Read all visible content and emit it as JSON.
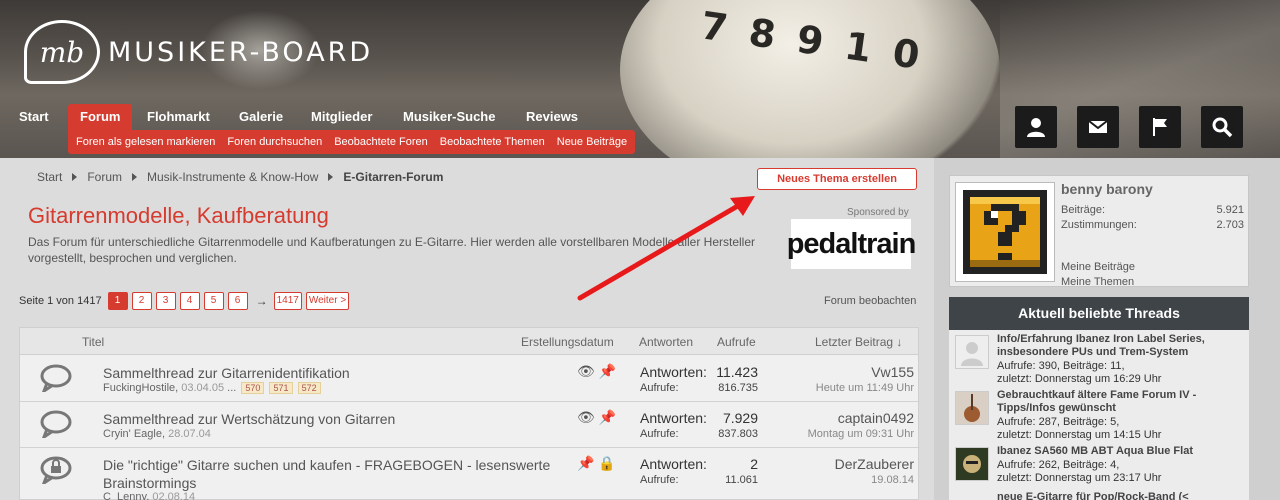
{
  "brand": {
    "name": "MUSIKER-BOARD",
    "accent": "#d63b2f"
  },
  "nav": {
    "items": [
      "Start",
      "Forum",
      "Flohmarkt",
      "Galerie",
      "Mitglieder",
      "Musiker-Suche",
      "Reviews"
    ],
    "active": "Forum",
    "subnav": [
      "Foren als gelesen markieren",
      "Foren durchsuchen",
      "Beobachtete Foren",
      "Beobachtete Themen",
      "Neue Beiträge"
    ],
    "icon_buttons": [
      "user-icon",
      "mail-icon",
      "flag-icon",
      "search-icon"
    ]
  },
  "breadcrumb": [
    "Start",
    "Forum",
    "Musik-Instrumente & Know-How",
    "E-Gitarren-Forum"
  ],
  "new_thread_label": "Neues Thema erstellen",
  "page": {
    "title": "Gitarrenmodelle, Kaufberatung",
    "description": "Das Forum für unterschiedliche Gitarrenmodelle und Kaufberatungen zu E-Gitarre. Hier werden alle vorstellbaren Modelle aller Hersteller vorgestellt, besprochen und verglichen."
  },
  "sponsor": {
    "label": "Sponsored by",
    "name": "pedaltrain"
  },
  "pagination": {
    "label": "Seite 1 von 1417",
    "pages": [
      "1",
      "2",
      "3",
      "4",
      "5",
      "6"
    ],
    "current": "1",
    "arrow": "→",
    "last": "1417",
    "next": "Weiter >"
  },
  "watch_forum": "Forum beobachten",
  "table": {
    "columns": {
      "title": "Titel",
      "created": "Erstellungsdatum",
      "answers": "Antworten",
      "views": "Aufrufe",
      "last": "Letzter Beitrag ↓"
    },
    "rows": [
      {
        "title": "Sammelthread zur Gitarrenidentifikation",
        "author": "FuckingHostile",
        "date": "03.04.05",
        "ellipsis": "...",
        "mini_pages": [
          "570",
          "571",
          "572"
        ],
        "answers_label": "Antworten:",
        "answers": "11.423",
        "views_label": "Aufrufe:",
        "views": "816.735",
        "last_user": "Vw155",
        "last_date": "Heute um 11:49 Uhr"
      },
      {
        "title": "Sammelthread zur Wertschätzung von Gitarren",
        "author": "Cryin' Eagle",
        "date": "28.07.04",
        "answers_label": "Antworten:",
        "answers": "7.929",
        "views_label": "Aufrufe:",
        "views": "837.803",
        "last_user": "captain0492",
        "last_date": "Montag um 09:31 Uhr"
      },
      {
        "title": "Die \"richtige\" Gitarre suchen und kaufen - FRAGEBOGEN - lesenswerte Brainstormings",
        "author": "C_Lenny",
        "date": "02.08.14",
        "answers_label": "Antworten:",
        "answers": "2",
        "views_label": "Aufrufe:",
        "views": "11.061",
        "last_user": "DerZauberer",
        "last_date": "19.08.14"
      }
    ]
  },
  "user": {
    "name": "benny barony",
    "posts_label": "Beiträge:",
    "posts": "5.921",
    "likes_label": "Zustimmungen:",
    "likes": "2.703",
    "link1": "Meine Beiträge",
    "link2": "Meine Themen"
  },
  "popular": {
    "title": "Aktuell beliebte Threads",
    "items": [
      {
        "title": "Info/Erfahrung Ibanez Iron Label Series, insbesondere PUs und Trem-System",
        "meta1": "Aufrufe: 390, Beiträge: 11,",
        "meta2": "zuletzt: Donnerstag um 16:29 Uhr"
      },
      {
        "title": "Gebrauchtkauf ältere Fame Forum IV - Tipps/Infos gewünscht",
        "meta1": "Aufrufe: 287, Beiträge: 5,",
        "meta2": "zuletzt: Donnerstag um 14:15 Uhr"
      },
      {
        "title": "Ibanez SA560 MB ABT Aqua Blue Flat",
        "meta1": "Aufrufe: 262, Beiträge: 4,",
        "meta2": "zuletzt: Donnerstag um 23:17 Uhr"
      },
      {
        "title": "neue E-Gitarre für Pop/Rock-Band (<",
        "meta1": "",
        "meta2": ""
      }
    ]
  }
}
